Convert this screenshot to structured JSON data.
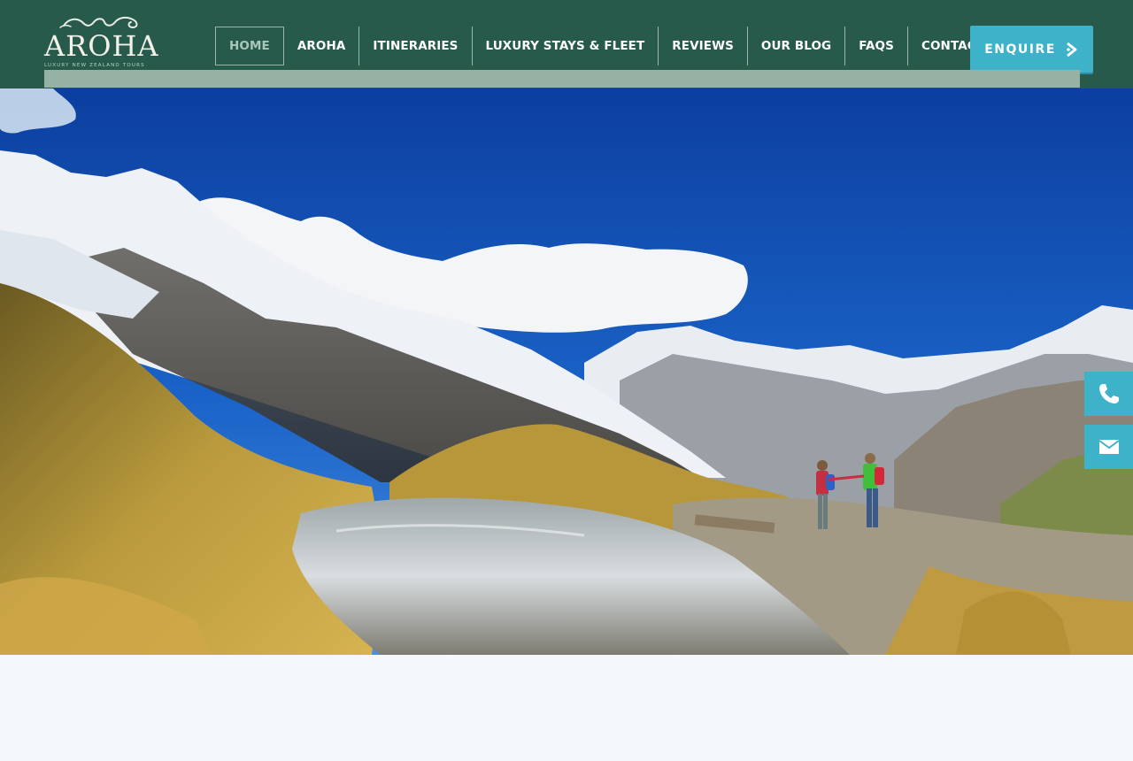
{
  "brand": {
    "name": "AROHA",
    "tagline": "LUXURY NEW ZEALAND TOURS"
  },
  "nav": {
    "items": [
      {
        "label": "HOME",
        "active": true
      },
      {
        "label": "AROHA"
      },
      {
        "label": "ITINERARIES"
      },
      {
        "label": "LUXURY STAYS & FLEET"
      },
      {
        "label": "REVIEWS"
      },
      {
        "label": "OUR BLOG"
      },
      {
        "label": "FAQS"
      },
      {
        "label": "CONTACT"
      }
    ]
  },
  "cta": {
    "label": "ENQUIRE"
  },
  "icons": {
    "phone": "phone-icon",
    "email": "email-icon",
    "enquire": "arrow-icon"
  },
  "colors": {
    "header": "#275a4b",
    "accent": "#3eb2c9",
    "sub_bar": "#96b2a4",
    "page_bg": "#f4f8fb"
  }
}
